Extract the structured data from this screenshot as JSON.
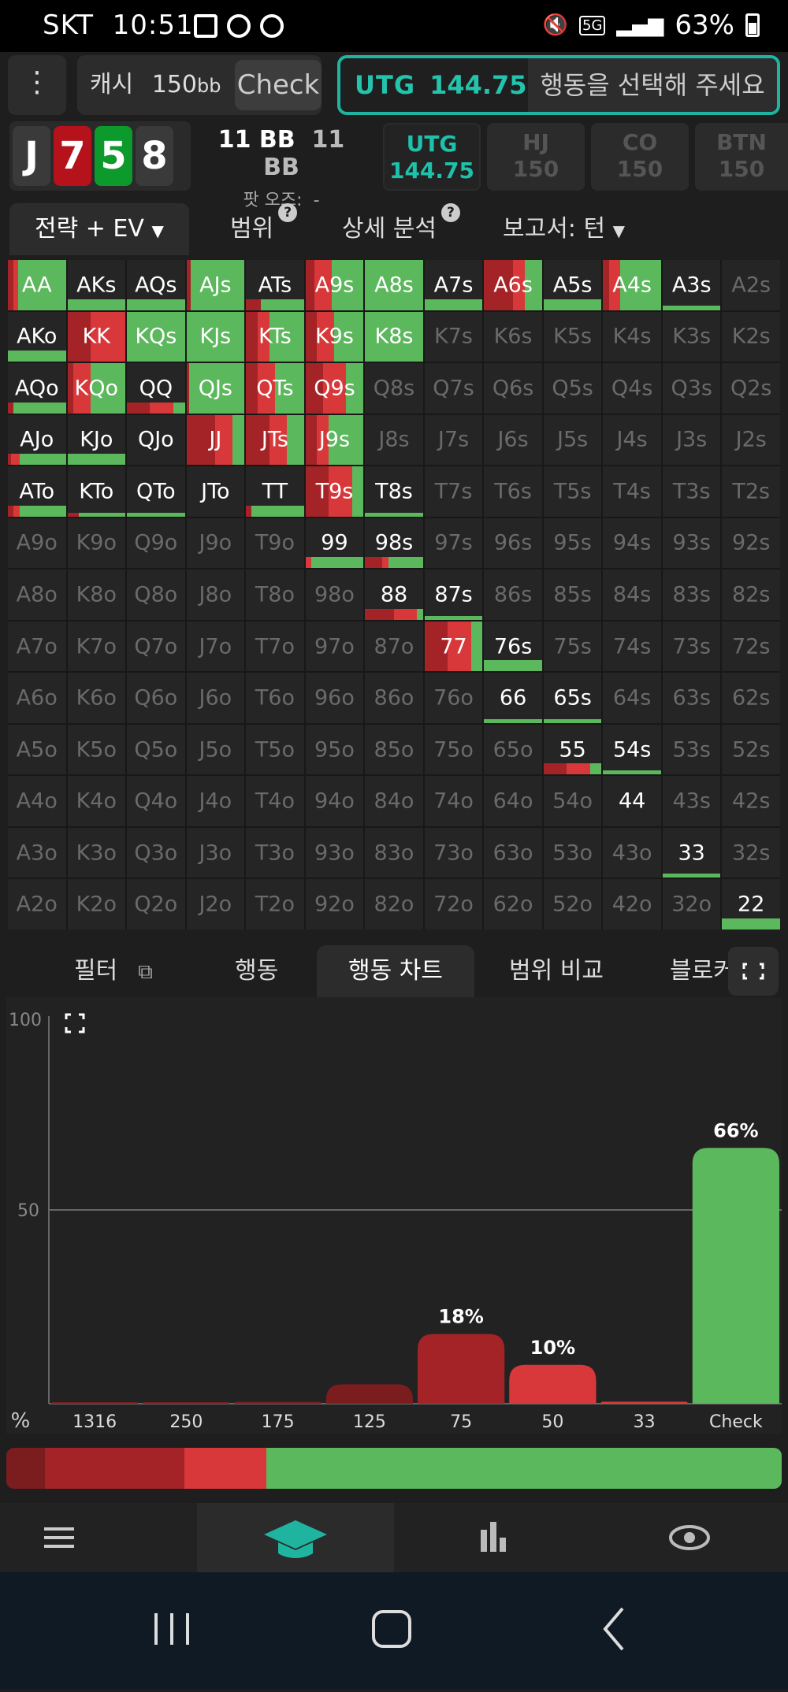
{
  "status": {
    "carrier": "SKT",
    "time": "10:51",
    "battery": "63%",
    "network": "5G"
  },
  "topbar": {
    "cash_label": "캐시",
    "stack": "150",
    "stack_unit": "bb",
    "check_label": "Check"
  },
  "decision": {
    "position": "UTG",
    "stack": "144.75",
    "prompt": "행동을 선택해 주세요"
  },
  "board": [
    {
      "rank": "J",
      "color": "#3a3a3a"
    },
    {
      "rank": "7",
      "color": "#b5121b"
    },
    {
      "rank": "5",
      "color": "#0b9a2b"
    },
    {
      "rank": "8",
      "color": "#3a3a3a"
    }
  ],
  "info": {
    "bb1": "11 BB",
    "bb2": "11 BB",
    "pot_odds_label": "팟 오즈:",
    "pot_odds_value": "-"
  },
  "seats": [
    {
      "name": "UTG",
      "stack": "144.75",
      "active": true
    },
    {
      "name": "HJ",
      "stack": "150",
      "active": false
    },
    {
      "name": "CO",
      "stack": "150",
      "active": false
    },
    {
      "name": "BTN",
      "stack": "150",
      "active": false
    }
  ],
  "tabs1": {
    "strategy": "전략 + EV",
    "range": "범위",
    "detail": "상세 분석",
    "report": "보고서: 턴"
  },
  "colors": {
    "check": "#5cb85c",
    "bet_small": "#d9383a",
    "bet_mid": "#a42326",
    "bet_big": "#7b1c1f",
    "accent": "#1fb4a0"
  },
  "hands": [
    [
      "AA",
      "AKs",
      "AQs",
      "AJs",
      "ATs",
      "A9s",
      "A8s",
      "A7s",
      "A6s",
      "A5s",
      "A4s",
      "A3s",
      "A2s"
    ],
    [
      "AKo",
      "KK",
      "KQs",
      "KJs",
      "KTs",
      "K9s",
      "K8s",
      "K7s",
      "K6s",
      "K5s",
      "K4s",
      "K3s",
      "K2s"
    ],
    [
      "AQo",
      "KQo",
      "QQ",
      "QJs",
      "QTs",
      "Q9s",
      "Q8s",
      "Q7s",
      "Q6s",
      "Q5s",
      "Q4s",
      "Q3s",
      "Q2s"
    ],
    [
      "AJo",
      "KJo",
      "QJo",
      "JJ",
      "JTs",
      "J9s",
      "J8s",
      "J7s",
      "J6s",
      "J5s",
      "J4s",
      "J3s",
      "J2s"
    ],
    [
      "ATo",
      "KTo",
      "QTo",
      "JTo",
      "TT",
      "T9s",
      "T8s",
      "T7s",
      "T6s",
      "T5s",
      "T4s",
      "T3s",
      "T2s"
    ],
    [
      "A9o",
      "K9o",
      "Q9o",
      "J9o",
      "T9o",
      "99",
      "98s",
      "97s",
      "96s",
      "95s",
      "94s",
      "93s",
      "92s"
    ],
    [
      "A8o",
      "K8o",
      "Q8o",
      "J8o",
      "T8o",
      "98o",
      "88",
      "87s",
      "86s",
      "85s",
      "84s",
      "83s",
      "82s"
    ],
    [
      "A7o",
      "K7o",
      "Q7o",
      "J7o",
      "T7o",
      "97o",
      "87o",
      "77",
      "76s",
      "75s",
      "74s",
      "73s",
      "72s"
    ],
    [
      "A6o",
      "K6o",
      "Q6o",
      "J6o",
      "T6o",
      "96o",
      "86o",
      "76o",
      "66",
      "65s",
      "64s",
      "63s",
      "62s"
    ],
    [
      "A5o",
      "K5o",
      "Q5o",
      "J5o",
      "T5o",
      "95o",
      "85o",
      "75o",
      "65o",
      "55",
      "54s",
      "53s",
      "52s"
    ],
    [
      "A4o",
      "K4o",
      "Q4o",
      "J4o",
      "T4o",
      "94o",
      "84o",
      "74o",
      "64o",
      "54o",
      "44",
      "43s",
      "42s"
    ],
    [
      "A3o",
      "K3o",
      "Q3o",
      "J3o",
      "T3o",
      "93o",
      "83o",
      "73o",
      "63o",
      "53o",
      "43o",
      "33",
      "32s"
    ],
    [
      "A2o",
      "K2o",
      "Q2o",
      "J2o",
      "T2o",
      "92o",
      "82o",
      "72o",
      "62o",
      "52o",
      "42o",
      "32o",
      "22"
    ]
  ],
  "tabs2": {
    "filter": "필터",
    "action": "행동",
    "action_chart": "행동 차트",
    "range_compare": "범위 비교",
    "blocker": "블로커"
  },
  "chart_data": {
    "type": "bar",
    "categories": [
      "1316",
      "250",
      "175",
      "125",
      "75",
      "50",
      "33",
      "Check"
    ],
    "values": [
      0,
      0.3,
      0.5,
      5,
      18,
      10,
      0.5,
      66
    ],
    "value_labels": [
      "",
      "",
      "",
      "",
      "18%",
      "10%",
      "",
      "66%"
    ],
    "ylim": [
      0,
      100
    ],
    "yticks": [
      "100",
      "50"
    ],
    "ylabel": "%",
    "colors": [
      "#7b1c1f",
      "#7b1c1f",
      "#7b1c1f",
      "#7b1c1f",
      "#a42326",
      "#d9383a",
      "#d9383a",
      "#5cb85c"
    ]
  },
  "action_summary": [
    {
      "share": 5,
      "color": "#7b1c1f"
    },
    {
      "share": 18,
      "color": "#a42326"
    },
    {
      "share": 10.5,
      "color": "#d9383a"
    },
    {
      "share": 66.5,
      "color": "#5cb85c"
    }
  ],
  "nav": [
    "menu-icon",
    "study-icon",
    "stats-icon",
    "eye-icon"
  ]
}
